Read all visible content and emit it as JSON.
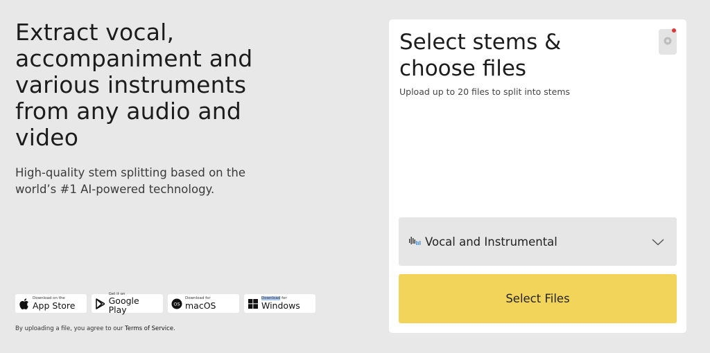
{
  "hero": {
    "headline": "Extract vocal,\naccompaniment and\nvarious instruments\nfrom any audio and\nvideo",
    "subheadline": "High-quality stem splitting based on the\nworld’s #1 AI-powered technology."
  },
  "stores": [
    {
      "small": "Download on the",
      "big": "App Store",
      "icon": "apple-icon"
    },
    {
      "small": "Get it on",
      "big": "Google Play",
      "icon": "google-play-icon"
    },
    {
      "small": "Download for",
      "big": "macOS",
      "icon": "macos-icon"
    },
    {
      "small_highlight": "Download",
      "small_rest": " for",
      "big": "Windows",
      "icon": "windows-icon"
    }
  ],
  "terms": {
    "prefix": "By uploading a file, you agree to our ",
    "link": "Terms of Service",
    "suffix": "."
  },
  "card": {
    "title": "Select stems &\nchoose files",
    "subtitle": "Upload up to 20 files to split into stems",
    "select_value": "Vocal and Instrumental",
    "button_label": "Select Files"
  },
  "colors": {
    "background": "#e8e8e8",
    "button": "#f2d45a",
    "notification_dot": "#e0383a"
  }
}
